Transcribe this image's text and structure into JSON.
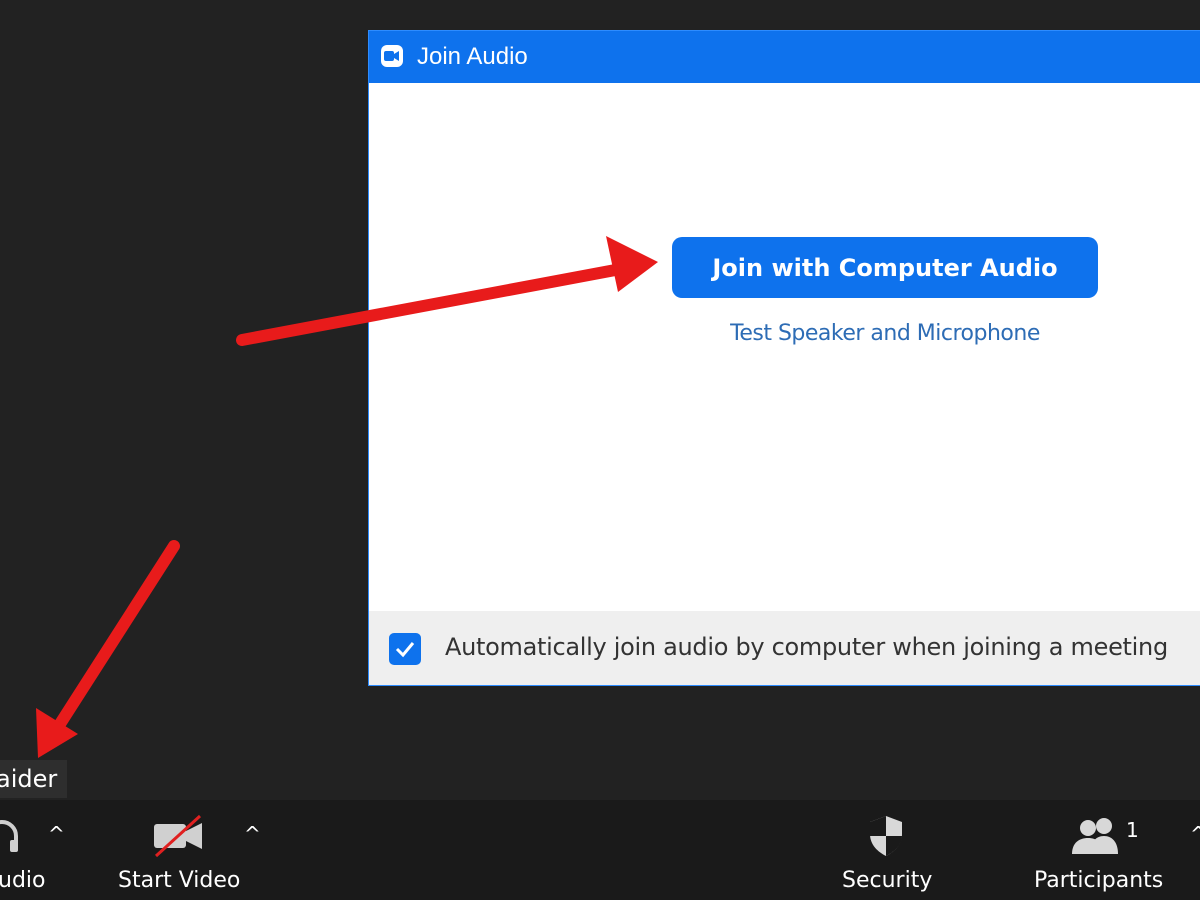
{
  "dialog": {
    "title": "Join Audio",
    "join_button_label": "Join with Computer Audio",
    "test_link_label": "Test Speaker and Microphone",
    "auto_join_label": "Automatically join audio by computer when joining a meeting",
    "auto_join_checked": true
  },
  "participant": {
    "name_fragment": "aider"
  },
  "toolbar": {
    "audio_label": "udio",
    "video_label": "Start Video",
    "security_label": "Security",
    "participants_label": "Participants",
    "participants_count": "1",
    "caret": "^"
  },
  "colors": {
    "accent": "#0e72ed",
    "background": "#222222",
    "annotation": "#e81b1b"
  }
}
